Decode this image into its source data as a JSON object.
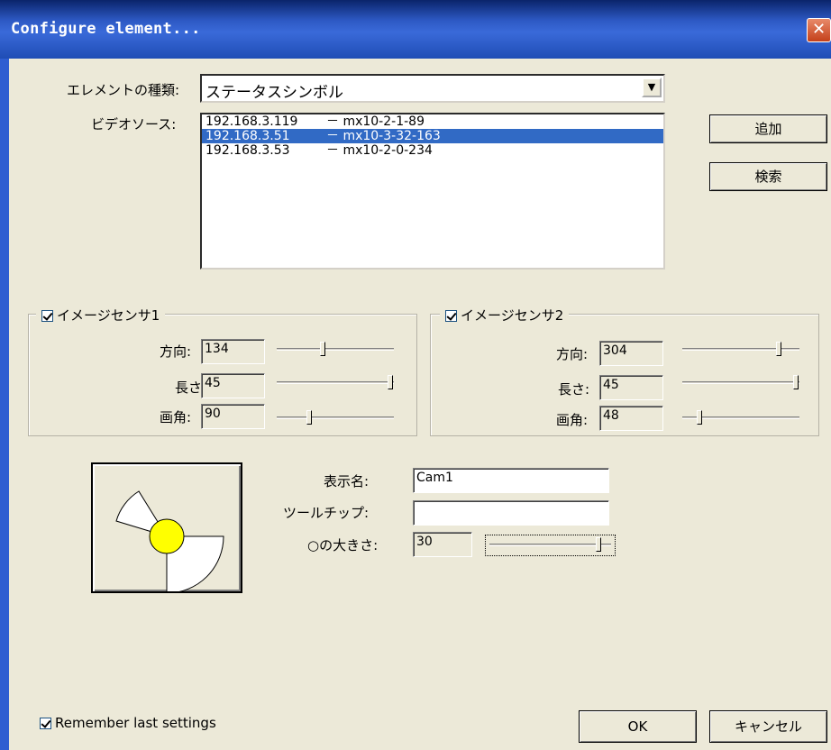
{
  "window": {
    "title": "Configure element..."
  },
  "element_type": {
    "label": "エレメントの種類:",
    "value": "ステータスシンボル"
  },
  "video_source": {
    "label": "ビデオソース:",
    "items": [
      {
        "ip": "192.168.3.119",
        "device": "－  mx10-2-1-89"
      },
      {
        "ip": "192.168.3.51",
        "device": "－  mx10-3-32-163"
      },
      {
        "ip": "192.168.3.53",
        "device": "－  mx10-2-0-234"
      }
    ],
    "selected_index": 1
  },
  "buttons": {
    "add": "追加",
    "search": "検索",
    "ok": "OK",
    "cancel": "キャンセル"
  },
  "sensor1": {
    "title": "イメージセンサ1",
    "direction_label": "方向:",
    "direction_value": "134",
    "length_label": "長さ",
    "length_value": "45",
    "angle_label": "画角:",
    "angle_value": "90"
  },
  "sensor2": {
    "title": "イメージセンサ2",
    "direction_label": "方向:",
    "direction_value": "304",
    "length_label": "長さ:",
    "length_value": "45",
    "angle_label": "画角:",
    "angle_value": "48"
  },
  "display": {
    "name_label": "表示名:",
    "name_value": "Cam1",
    "tooltip_label": "ツールチップ:",
    "tooltip_value": "",
    "size_label": "○の大きさ:",
    "size_value": "30"
  },
  "remember": {
    "label": "Remember last settings",
    "checked": true
  },
  "colors": {
    "title_bar": "#2d59c4",
    "selection": "#316ac5",
    "symbol_circle": "#ffff00"
  }
}
